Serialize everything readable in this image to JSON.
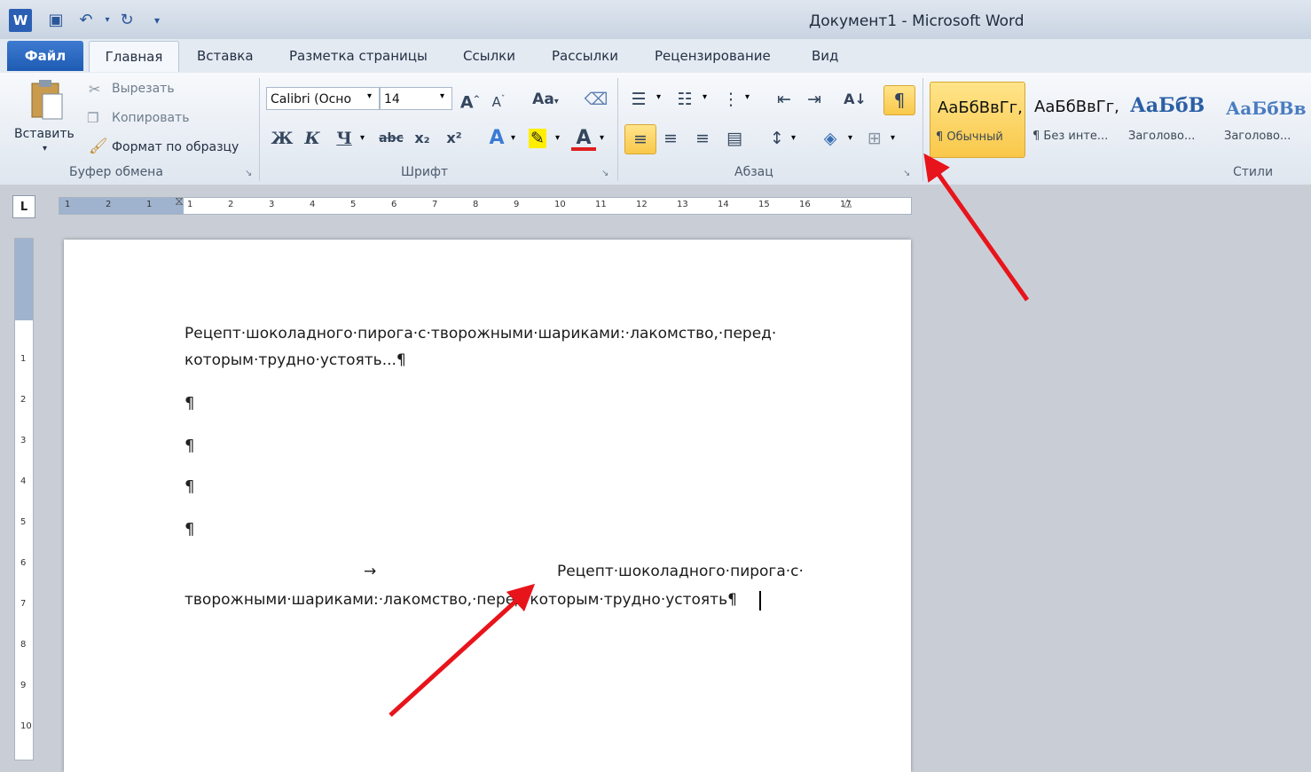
{
  "window": {
    "title": "Документ1 - Microsoft Word"
  },
  "qat": {
    "icons": [
      "word-logo-icon",
      "save-icon",
      "undo-icon",
      "redo-icon",
      "customize-qat-icon"
    ]
  },
  "tabs": [
    "Файл",
    "Главная",
    "Вставка",
    "Разметка страницы",
    "Ссылки",
    "Рассылки",
    "Рецензирование",
    "Вид"
  ],
  "clipboard": {
    "paste_label": "Вставить",
    "cut_label": "Вырезать",
    "copy_label": "Копировать",
    "format_painter_label": "Формат по образцу",
    "group_label": "Буфер обмена"
  },
  "font": {
    "family_value": "Calibri (Осно",
    "size_value": "14",
    "bold": "Ж",
    "italic": "К",
    "underline": "Ч",
    "strike": "abc",
    "subscript": "x₂",
    "superscript": "x²",
    "change_case": "Aa",
    "group_label": "Шрифт"
  },
  "paragraph": {
    "group_label": "Абзац",
    "show_marks": "¶"
  },
  "styles": {
    "group_label": "Стили",
    "items": [
      {
        "sample": "АаБбВвГг,",
        "name": "¶ Обычный"
      },
      {
        "sample": "АаБбВвГг,",
        "name": "¶ Без инте..."
      },
      {
        "sample": "АаБбВ",
        "name": "Заголово..."
      },
      {
        "sample": "АаБбВв",
        "name": "Заголово..."
      }
    ]
  },
  "ruler": {
    "corner": "L",
    "h_ticks": [
      "1",
      "2",
      "1",
      "1",
      "2",
      "3",
      "4",
      "5",
      "6",
      "7",
      "8",
      "9",
      "10",
      "11",
      "12",
      "13",
      "14",
      "15",
      "16",
      "17"
    ],
    "v_ticks": [
      "1",
      "2",
      "3",
      "4",
      "5",
      "6",
      "7",
      "8",
      "9",
      "10"
    ]
  },
  "document": {
    "para1_line1": "Рецепт·шоколадного·пирога·с·творожными·шариками:·лакомство,·перед·",
    "para1_line2": "которым·трудно·устоять...¶",
    "empty_marks": [
      "¶",
      "¶",
      "¶",
      "¶"
    ],
    "tab_arrow": "→",
    "para2_line1": "Рецепт·шоколадного·пирога·с·",
    "para2_line2": "творожными·шариками:·лакомство,·перед·которым·трудно·устоять¶"
  },
  "colors": {
    "arrow": "#e8141b",
    "file_tab": "#2b64bb",
    "highlight": "#f9c84a"
  }
}
